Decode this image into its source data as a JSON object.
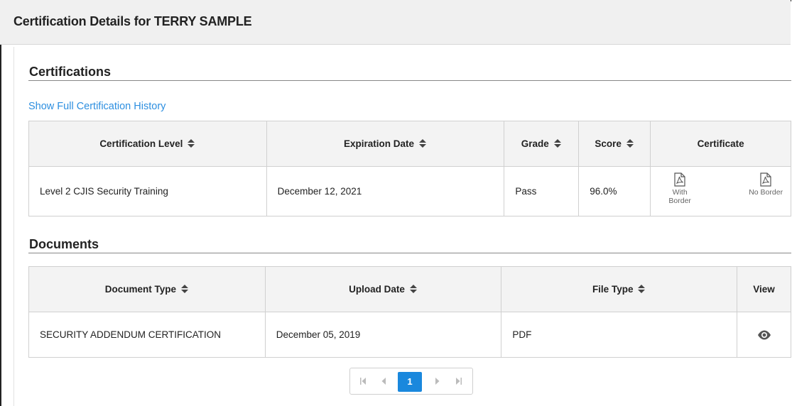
{
  "header": {
    "title": "Certification Details for TERRY SAMPLE"
  },
  "certifications": {
    "title": "Certifications",
    "history_link": "Show Full Certification History",
    "columns": [
      "Certification Level",
      "Expiration Date",
      "Grade",
      "Score",
      "Certificate"
    ],
    "rows": [
      {
        "level": "Level 2 CJIS Security Training",
        "expiration": "December 12, 2021",
        "grade": "Pass",
        "score": "96.0%",
        "cert_with_border": "With Border",
        "cert_no_border": "No Border"
      }
    ]
  },
  "documents": {
    "title": "Documents",
    "columns": [
      "Document Type",
      "Upload Date",
      "File Type",
      "View"
    ],
    "rows": [
      {
        "type": "SECURITY ADDENDUM CERTIFICATION",
        "upload_date": "December 05, 2019",
        "file_type": "PDF",
        "view_icon": "eye-icon"
      }
    ]
  },
  "pagination": {
    "current_page": "1"
  },
  "colors": {
    "link": "#2d8fe0",
    "accent": "#1a88dd",
    "header_bg": "#f0f0f0",
    "table_header_bg": "#f3f3f3"
  },
  "icons": [
    "sort-icon",
    "pdf-icon",
    "eye-icon",
    "first-page-icon",
    "prev-page-icon",
    "next-page-icon",
    "last-page-icon"
  ]
}
